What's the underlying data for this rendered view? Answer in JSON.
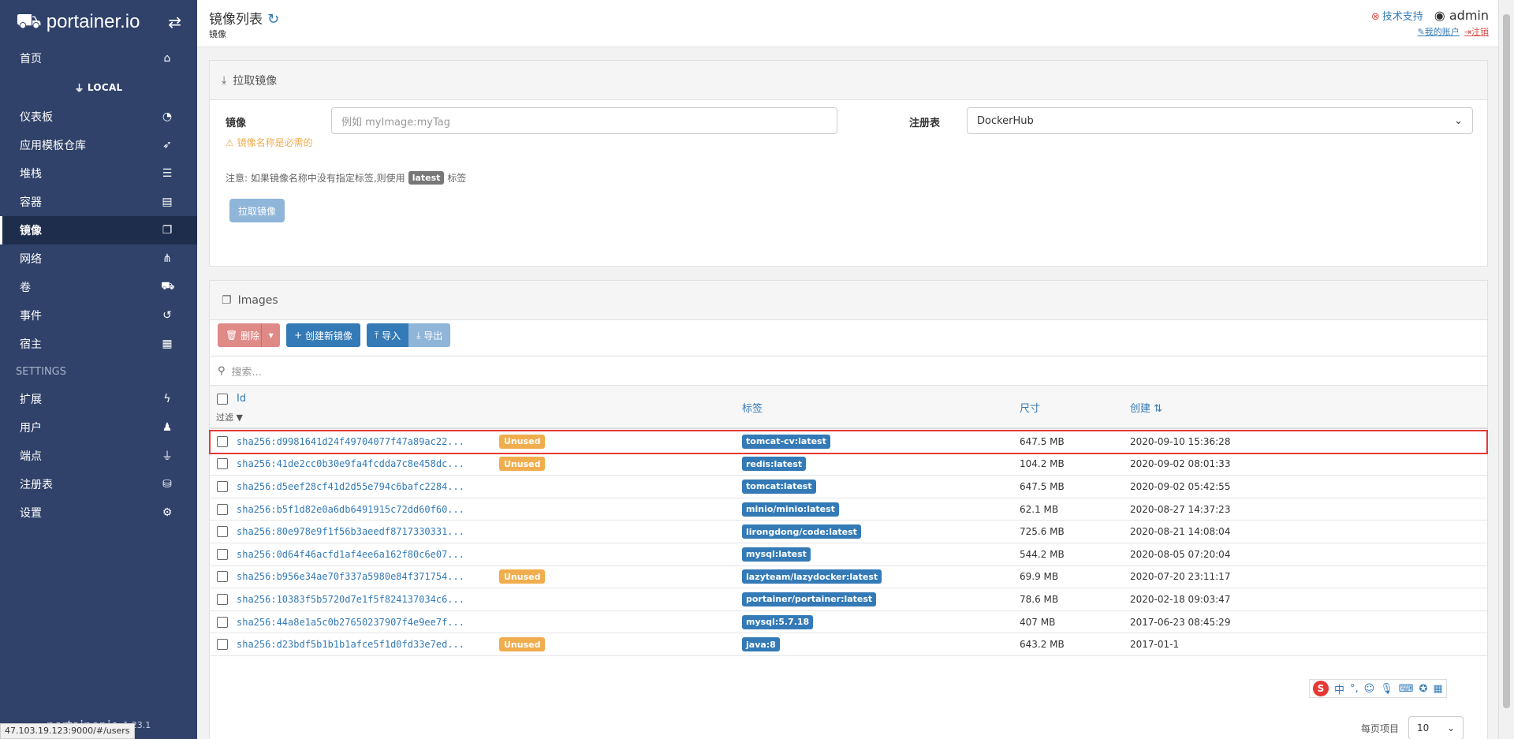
{
  "brand": {
    "logo": "portainer.io",
    "logo_icon": "cubes-icon",
    "swap_icon": "exchange-icon"
  },
  "sidebar": {
    "home": {
      "label": "首页",
      "icon": "home-icon"
    },
    "endpoint": "LOCAL",
    "items": [
      {
        "label": "仪表板",
        "icon": "dashboard-icon"
      },
      {
        "label": "应用模板仓库",
        "icon": "rocket-icon"
      },
      {
        "label": "堆栈",
        "icon": "list-icon"
      },
      {
        "label": "容器",
        "icon": "server-icon"
      },
      {
        "label": "镜像",
        "icon": "clone-icon"
      },
      {
        "label": "网络",
        "icon": "sitemap-icon"
      },
      {
        "label": "卷",
        "icon": "cubes-icon"
      },
      {
        "label": "事件",
        "icon": "history-icon"
      },
      {
        "label": "宿主",
        "icon": "th-icon"
      }
    ],
    "settings_heading": "SETTINGS",
    "settings_items": [
      {
        "label": "扩展",
        "icon": "bolt-icon"
      },
      {
        "label": "用户",
        "icon": "users-icon"
      },
      {
        "label": "端点",
        "icon": "plug-icon"
      },
      {
        "label": "注册表",
        "icon": "database-icon"
      },
      {
        "label": "设置",
        "icon": "cogs-icon"
      }
    ],
    "footer_logo": "portainer.io",
    "footer_version": "1.23.1"
  },
  "header": {
    "title": "镜像列表",
    "breadcrumb": "镜像",
    "support": "技术支持",
    "user": "admin",
    "my_account": "我的账户",
    "logout": "注销"
  },
  "pull": {
    "heading": "拉取镜像",
    "image_label": "镜像",
    "image_placeholder": "例如 myImage:myTag",
    "registry_label": "注册表",
    "registry_value": "DockerHub",
    "warning": "镜像名称是必需的",
    "note_prefix": "注意: 如果镜像名称中没有指定标签,则使用",
    "note_tag": "latest",
    "note_suffix": "标签",
    "pull_button": "拉取镜像"
  },
  "images": {
    "heading": "Images",
    "remove_button": "删除",
    "build_button": "创建新镜像",
    "import_button": "导入",
    "export_button": "导出",
    "search_placeholder": "搜索...",
    "columns": {
      "id": "Id",
      "filter": "过滤",
      "tags": "标签",
      "size": "尺寸",
      "created": "创建"
    },
    "unused_label": "Unused",
    "rows": [
      {
        "id": "sha256:d9981641d24f49704077f47a89ac22...",
        "unused": true,
        "tag": "tomcat-cv:latest",
        "size": "647.5 MB",
        "created": "2020-09-10 15:36:28"
      },
      {
        "id": "sha256:41de2cc0b30e9fa4fcdda7c8e458dc...",
        "unused": true,
        "tag": "redis:latest",
        "size": "104.2 MB",
        "created": "2020-09-02 08:01:33"
      },
      {
        "id": "sha256:d5eef28cf41d2d55e794c6bafc2284...",
        "unused": false,
        "tag": "tomcat:latest",
        "size": "647.5 MB",
        "created": "2020-09-02 05:42:55"
      },
      {
        "id": "sha256:b5f1d82e0a6db6491915c72dd60f60...",
        "unused": false,
        "tag": "minio/minio:latest",
        "size": "62.1 MB",
        "created": "2020-08-27 14:37:23"
      },
      {
        "id": "sha256:80e978e9f1f56b3aeedf8717330331...",
        "unused": false,
        "tag": "lirongdong/code:latest",
        "size": "725.6 MB",
        "created": "2020-08-21 14:08:04"
      },
      {
        "id": "sha256:0d64f46acfd1af4ee6a162f80c6e07...",
        "unused": false,
        "tag": "mysql:latest",
        "size": "544.2 MB",
        "created": "2020-08-05 07:20:04"
      },
      {
        "id": "sha256:b956e34ae70f337a5980e84f371754...",
        "unused": true,
        "tag": "lazyteam/lazydocker:latest",
        "size": "69.9 MB",
        "created": "2020-07-20 23:11:17"
      },
      {
        "id": "sha256:10383f5b5720d7e1f5f824137034c6...",
        "unused": false,
        "tag": "portainer/portainer:latest",
        "size": "78.6 MB",
        "created": "2020-02-18 09:03:47"
      },
      {
        "id": "sha256:44a8e1a5c0b27650237907f4e9ee7f...",
        "unused": false,
        "tag": "mysql:5.7.18",
        "size": "407 MB",
        "created": "2017-06-23 08:45:29"
      },
      {
        "id": "sha256:d23bdf5b1b1b1afce5f1d0fd33e7ed...",
        "unused": true,
        "tag": "java:8",
        "size": "643.2 MB",
        "created": "2017-01-1"
      }
    ],
    "per_page_label": "每页项目",
    "per_page_value": "10"
  },
  "status_url": "47.103.19.123:9000/#/users"
}
